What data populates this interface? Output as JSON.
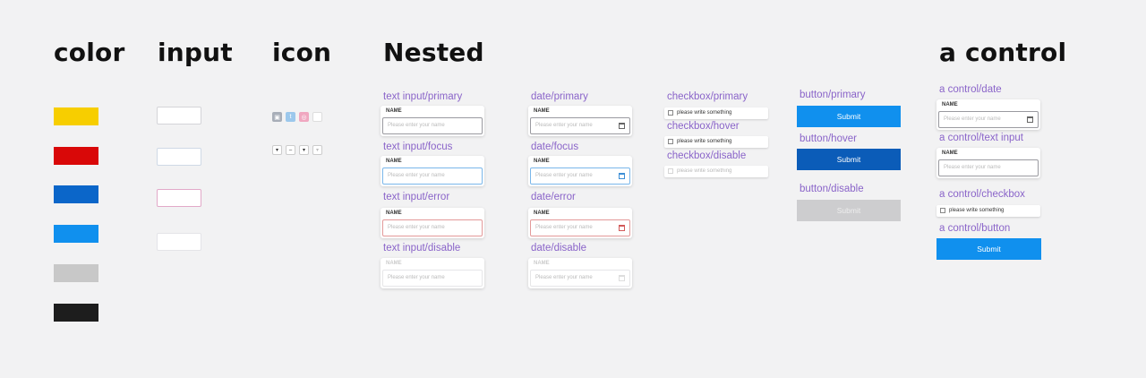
{
  "headings": {
    "color": "color",
    "input": "input",
    "icon": "icon",
    "nested": "Nested",
    "acontrol": "a control"
  },
  "colors": {
    "yellow": "#f7ce00",
    "red": "#d90808",
    "dark_blue": "#0b66c9",
    "light_blue": "#1090ee",
    "gray": "#c8c8c8",
    "black": "#1d1d1d"
  },
  "icons": [
    "image-icon",
    "twitter-icon",
    "instagram-icon",
    "blank-icon"
  ],
  "nested": {
    "text_input": {
      "primary_label": "text input/primary",
      "focus_label": "text input/focus",
      "error_label": "text input/error",
      "disable_label": "text input/disable",
      "field_label": "NAME",
      "placeholder": "Please enter your name"
    },
    "date": {
      "primary_label": "date/primary",
      "focus_label": "date/focus",
      "error_label": "date/error",
      "disable_label": "date/disable",
      "field_label": "NAME",
      "placeholder": "Please enter your name"
    },
    "checkbox": {
      "primary_label": "checkbox/primary",
      "hover_label": "checkbox/hover",
      "disable_label": "checkbox/disable",
      "text": "please write something"
    },
    "button": {
      "primary_label": "button/primary",
      "hover_label": "button/hover",
      "disable_label": "button/disable",
      "text": "Submit"
    }
  },
  "acontrol": {
    "date_label": "a control/date",
    "text_input_label": "a control/text input",
    "checkbox_label": "a control/checkbox",
    "button_label": "a control/button",
    "field_label": "NAME",
    "placeholder": "Please enter your name",
    "checkbox_text": "please write something",
    "button_text": "Submit"
  }
}
